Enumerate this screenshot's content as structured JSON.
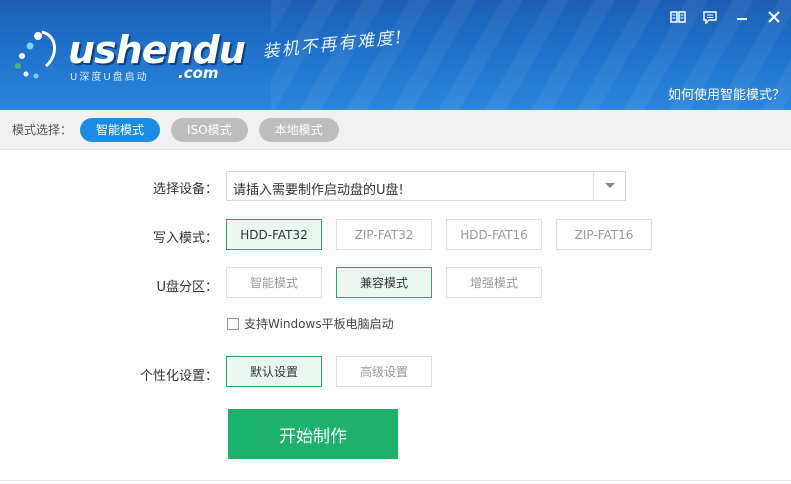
{
  "header": {
    "logo_main": "ushendu",
    "logo_sub": "U深度U盘启动",
    "logo_com": ".com",
    "slogan": "装机不再有难度!",
    "help_link": "如何使用智能模式？",
    "controls": [
      "book-icon",
      "chat-icon",
      "minimize-icon",
      "close-icon"
    ]
  },
  "modebar": {
    "label": "模式选择：",
    "modes": [
      "智能模式",
      "ISO模式",
      "本地模式"
    ],
    "active": "智能模式"
  },
  "form": {
    "device_label": "选择设备：",
    "device_value": "请插入需要制作启动盘的U盘!",
    "write_label": "写入模式：",
    "write_options": [
      "HDD-FAT32",
      "ZIP-FAT32",
      "HDD-FAT16",
      "ZIP-FAT16"
    ],
    "write_selected": "HDD-FAT32",
    "partition_label": "U盘分区：",
    "partition_options": [
      "智能模式",
      "兼容模式",
      "增强模式"
    ],
    "partition_selected": "兼容模式",
    "checkbox_label": "支持Windows平板电脑启动",
    "checkbox_checked": false,
    "personal_label": "个性化设置：",
    "personal_options": [
      "默认设置",
      "高级设置"
    ],
    "personal_selected": "默认设置",
    "start_button": "开始制作"
  },
  "colors": {
    "header_blue": "#1e6fc9",
    "active_pill": "#1a8de3",
    "selected_green": "#2ea66b",
    "start_green": "#1db26b"
  }
}
